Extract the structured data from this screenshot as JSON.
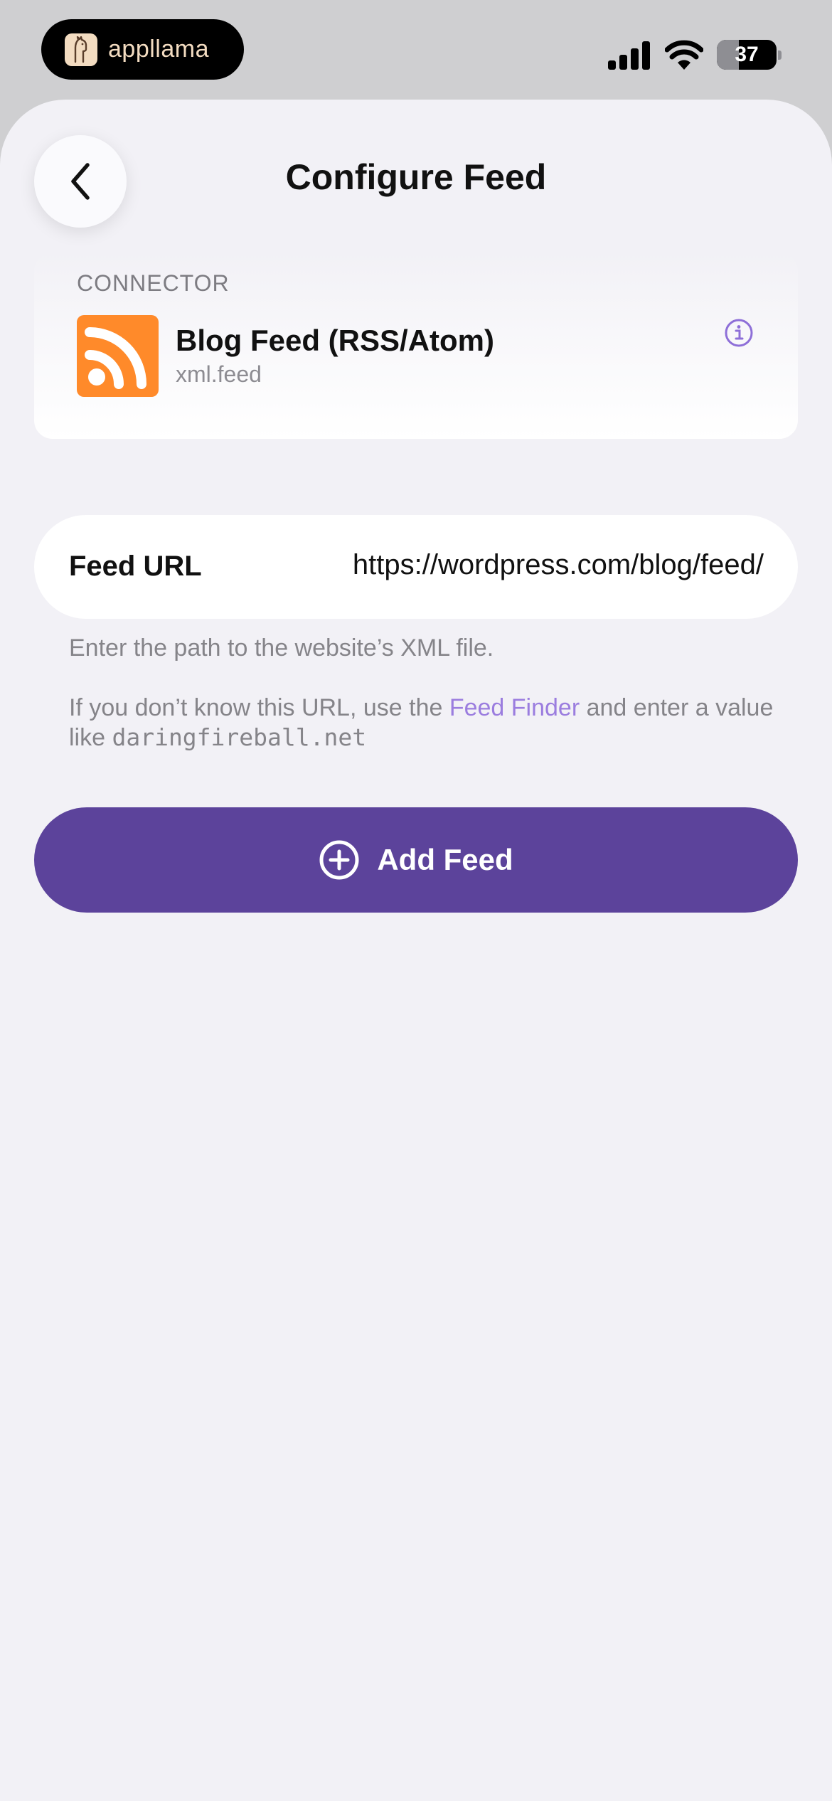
{
  "status_bar": {
    "app_name": "appllama",
    "battery": "37",
    "battery_level": 0.37
  },
  "header": {
    "title": "Configure Feed"
  },
  "connector": {
    "section_label": "CONNECTOR",
    "name": "Blog Feed (RSS/Atom)",
    "id": "xml.feed"
  },
  "feed_url": {
    "label": "Feed URL",
    "value": "https://wordpress.com/blog/feed/"
  },
  "hints": {
    "line1": "Enter the path to the website’s XML file.",
    "line2_prefix": "If you don’t know this URL, use the ",
    "line2_link": "Feed Finder",
    "line2_middle": " and enter a value like ",
    "line2_example": "daringfireball.net"
  },
  "actions": {
    "add_feed": "Add Feed"
  },
  "colors": {
    "accent": "#5c439b",
    "link": "#9b7ddf",
    "rss_orange": "#ff8a2a",
    "background": "#f2f1f6"
  }
}
